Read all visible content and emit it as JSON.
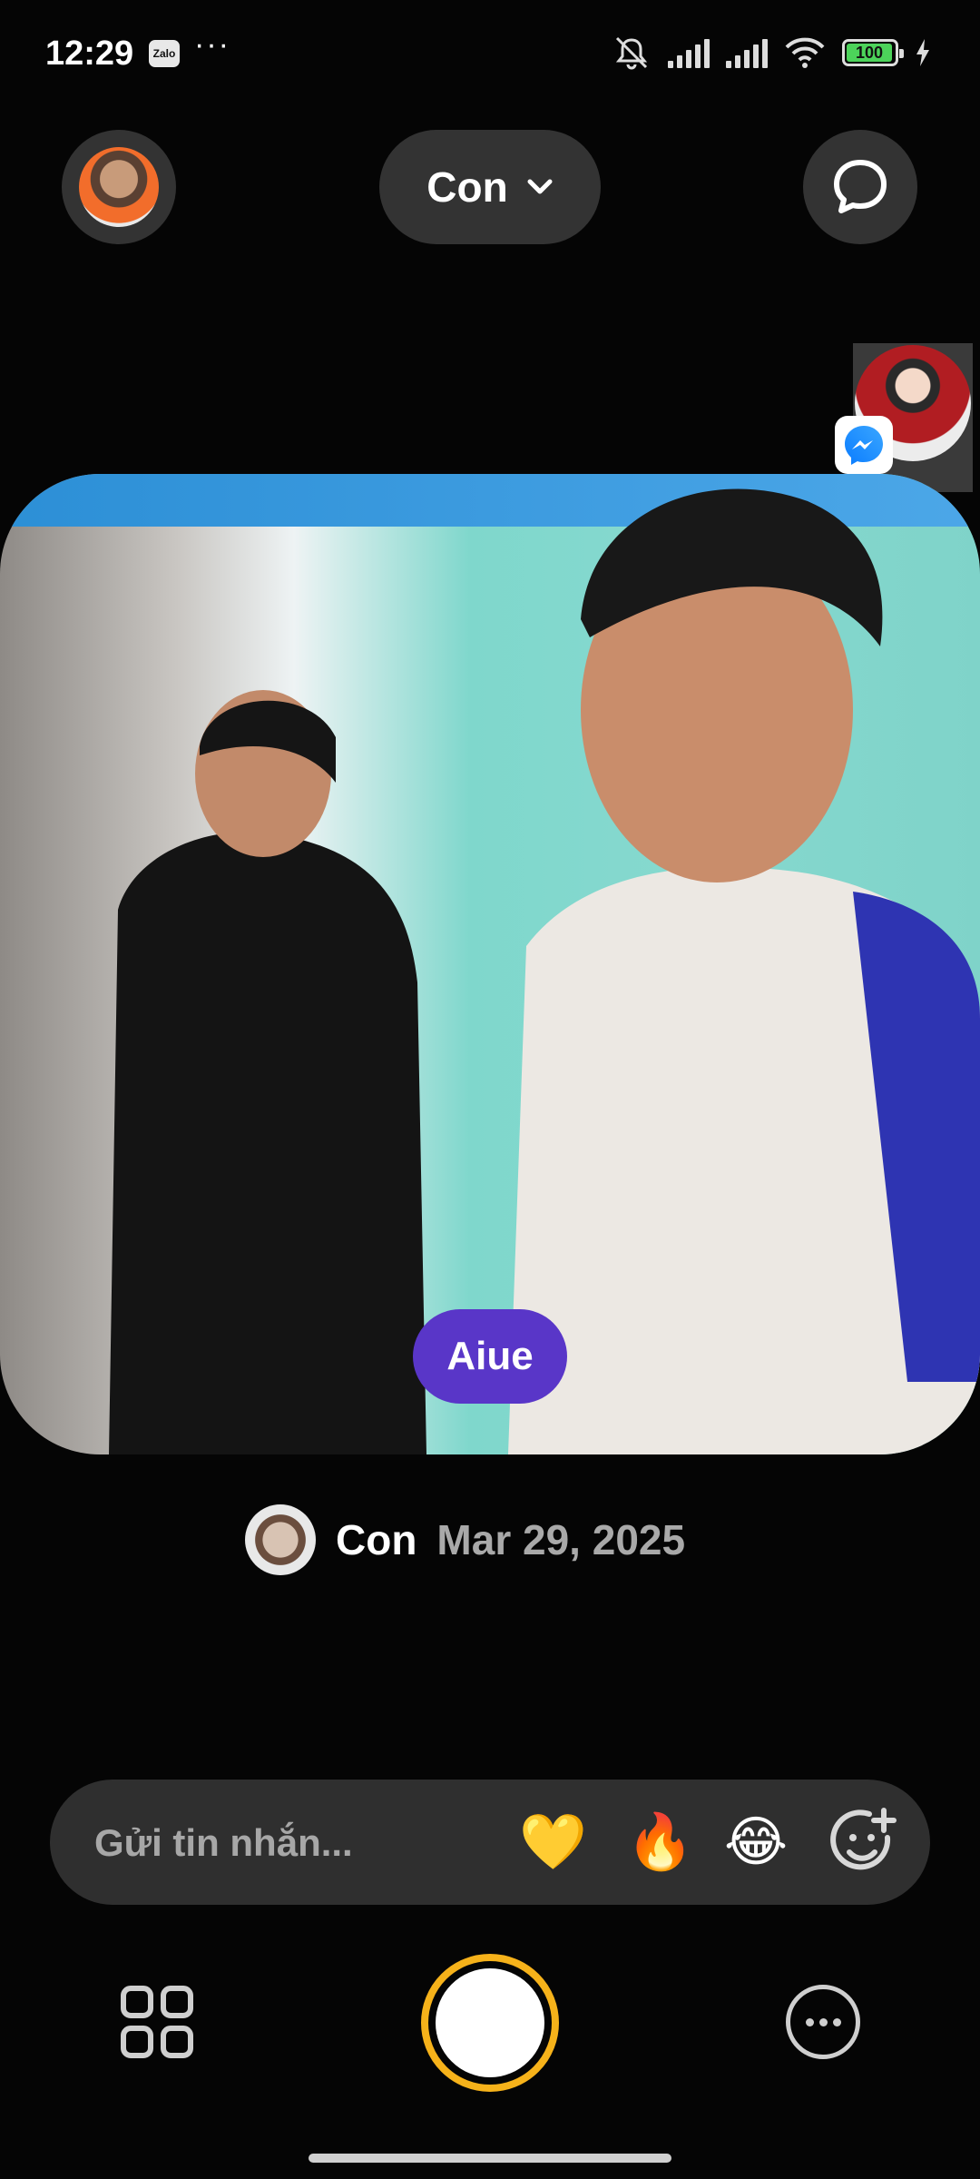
{
  "status_bar": {
    "time": "12:29",
    "zalo_label": "Zalo",
    "more": "···",
    "battery": "100"
  },
  "top_bar": {
    "filter_label": "Con"
  },
  "photo": {
    "caption": "Aiue"
  },
  "post": {
    "author": "Con",
    "date": "Mar 29, 2025"
  },
  "message_bar": {
    "placeholder": "Gửi tin nhắn...",
    "reactions": [
      "💛",
      "🔥",
      "😂"
    ]
  },
  "colors": {
    "background": "#050505",
    "caption_pill": "#5936c8",
    "shutter_ring": "#f6b21a",
    "battery_fill": "#4cd35a"
  },
  "icons": [
    "zalo-icon",
    "mute-icon",
    "signal-icon",
    "wifi-icon",
    "battery-icon",
    "chevron-down-icon",
    "chat-icon",
    "messenger-icon",
    "add-reaction-icon",
    "grid-icon",
    "more-icon"
  ]
}
